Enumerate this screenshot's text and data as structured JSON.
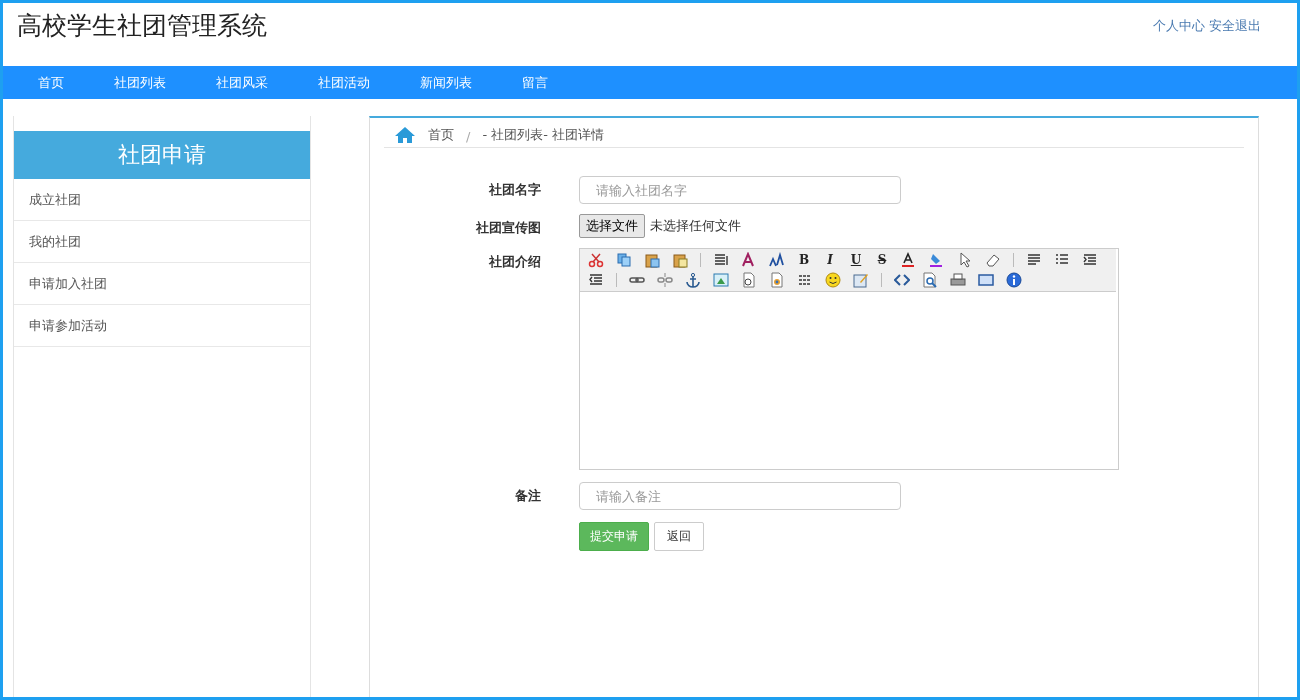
{
  "header": {
    "title": "高校学生社团管理系统",
    "links": [
      "个人中心",
      "安全退出"
    ]
  },
  "nav": [
    "首页",
    "社团列表",
    "社团风采",
    "社团活动",
    "新闻列表",
    "留言"
  ],
  "sidebar": {
    "title": "社团申请",
    "items": [
      "成立社团",
      "我的社团",
      "申请加入社团",
      "申请参加活动"
    ]
  },
  "breadcrumb": {
    "home": "首页",
    "separator": "/",
    "path": "- 社团列表- 社团详情"
  },
  "form": {
    "name_label": "社团名字",
    "name_placeholder": "请输入社团名字",
    "image_label": "社团宣传图",
    "file_button": "选择文件",
    "file_status": "未选择任何文件",
    "intro_label": "社团介绍",
    "format_buttons": [
      {
        "kind": "bold",
        "glyph": "B"
      },
      {
        "kind": "italic",
        "glyph": "I"
      },
      {
        "kind": "underline",
        "glyph": "U"
      },
      {
        "kind": "strike",
        "glyph": "S"
      }
    ],
    "note_label": "备注",
    "note_placeholder": "请输入备注",
    "submit": "提交申请",
    "back": "返回"
  }
}
